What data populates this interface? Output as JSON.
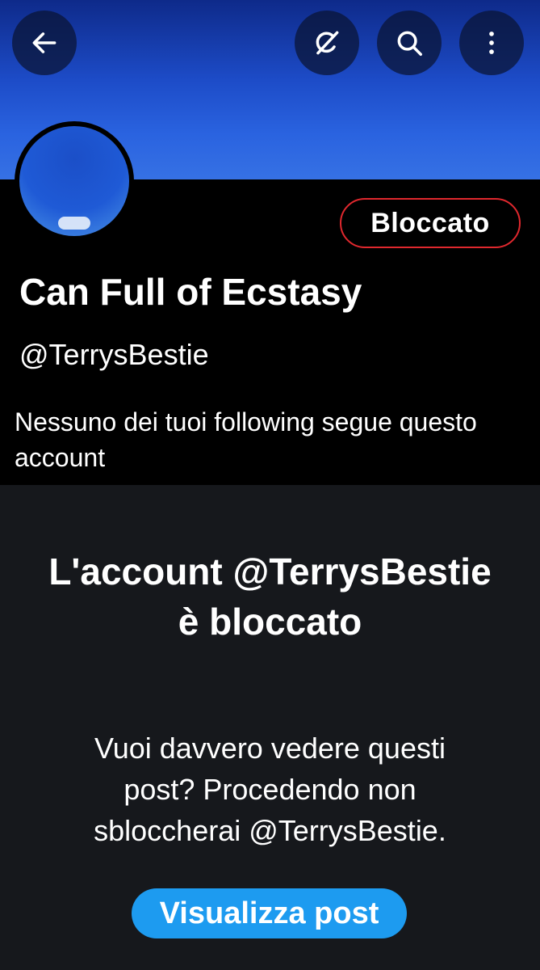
{
  "header": {
    "back_icon": "arrow-left-icon",
    "grok_icon": "grok-icon",
    "search_icon": "search-icon",
    "more_icon": "more-vertical-icon"
  },
  "profile": {
    "display_name": "Can Full of Ecstasy",
    "handle": "@TerrysBestie",
    "blocked_label": "Bloccato",
    "follow_info": "Nessuno dei tuoi following segue questo account"
  },
  "blocked_notice": {
    "title": "L'account @TerrysBestie è bloccato",
    "description": "Vuoi davvero vedere questi post? Procedendo non sbloccherai @TerrysBestie.",
    "button_label": "Visualizza post"
  },
  "colors": {
    "accent": "#1d9bf0",
    "blocked_border": "#e0282e",
    "background": "#16181c"
  }
}
